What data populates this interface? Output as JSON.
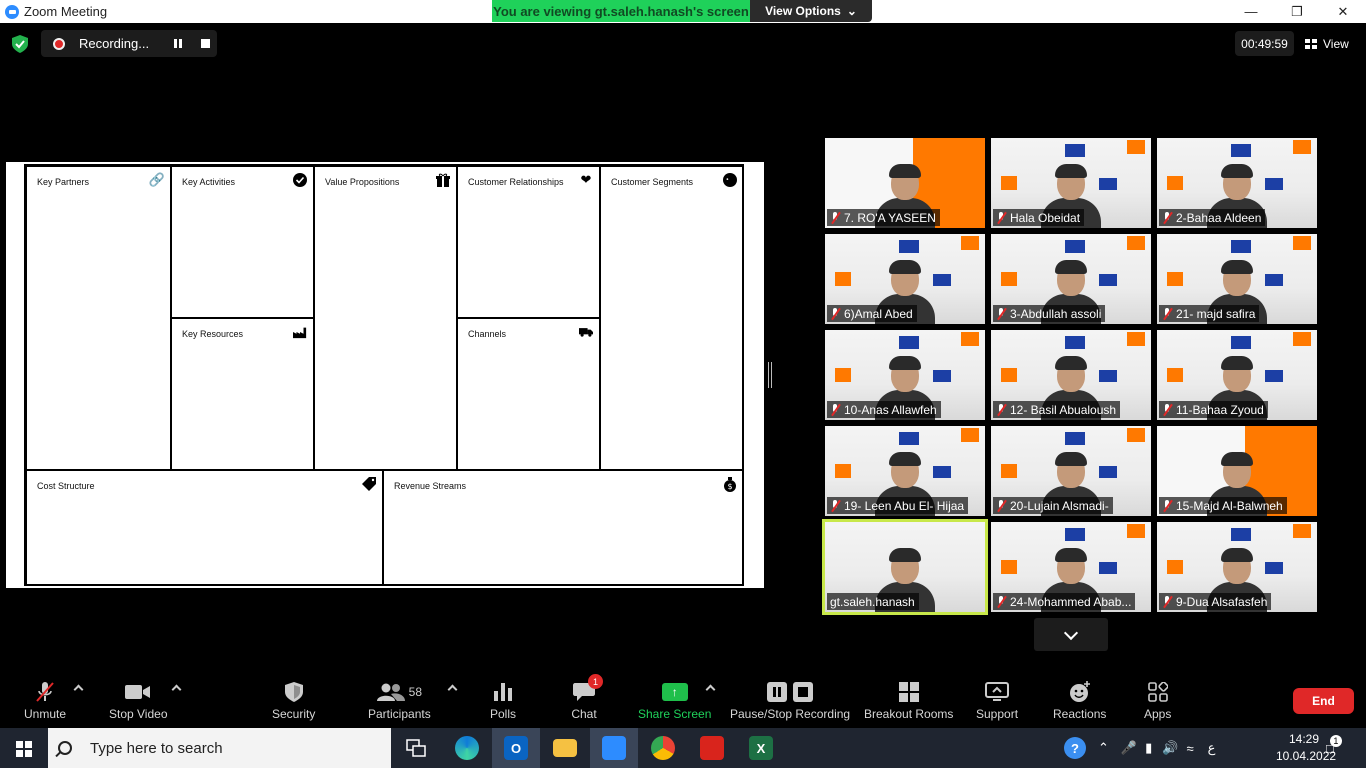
{
  "window": {
    "title": "Zoom Meeting"
  },
  "banner": {
    "viewing_text": "You are viewing gt.saleh.hanash's screen",
    "view_options": "View Options"
  },
  "topbar": {
    "recording_label": "Recording...",
    "timer": "00:49:59",
    "view_label": "View"
  },
  "canvas": {
    "key_partners": "Key Partners",
    "key_activities": "Key Activities",
    "key_resources": "Key Resources",
    "value_propositions": "Value Propositions",
    "customer_relationships": "Customer Relationships",
    "channels": "Channels",
    "customer_segments": "Customer Segments",
    "cost_structure": "Cost Structure",
    "revenue_streams": "Revenue Streams"
  },
  "participants": [
    {
      "name": "7. RO'A YASEEN",
      "muted": true
    },
    {
      "name": "Hala Obeidat",
      "muted": true
    },
    {
      "name": "2-Bahaa Aldeen",
      "muted": true
    },
    {
      "name": "6)Amal Abed",
      "muted": true
    },
    {
      "name": "3-Abdullah assoli",
      "muted": true
    },
    {
      "name": "21- majd safira",
      "muted": true
    },
    {
      "name": "10-Anas Allawfeh",
      "muted": true
    },
    {
      "name": "12- Basil Abualoush",
      "muted": true
    },
    {
      "name": "11-Bahaa Zyoud",
      "muted": true
    },
    {
      "name": "19- Leen  Abu El- Hijaa",
      "muted": true
    },
    {
      "name": "20-Lujain Alsmadi-",
      "muted": true
    },
    {
      "name": "15-Majd Al-Balwneh",
      "muted": true
    },
    {
      "name": "gt.saleh.hanash",
      "muted": false,
      "active_speaker": true
    },
    {
      "name": "24-Mohammed Abab...",
      "muted": true
    },
    {
      "name": "9-Dua Alsafasfeh",
      "muted": true
    }
  ],
  "toolbar": {
    "unmute": "Unmute",
    "stop_video": "Stop Video",
    "security": "Security",
    "participants": "Participants",
    "participants_count": "58",
    "polls": "Polls",
    "chat": "Chat",
    "chat_badge": "1",
    "share_screen": "Share Screen",
    "pause_recording": "Pause/Stop Recording",
    "breakout_rooms": "Breakout Rooms",
    "support": "Support",
    "reactions": "Reactions",
    "apps": "Apps",
    "end": "End"
  },
  "taskbar": {
    "search_placeholder": "Type here to search",
    "time": "14:29",
    "date": "10.04.2022",
    "language": "ع",
    "notifications": "1"
  },
  "colors": {
    "accent_green": "#1fd15a",
    "end_red": "#e02828",
    "active_outline": "#c8e84a",
    "orange": "#ff7900"
  }
}
